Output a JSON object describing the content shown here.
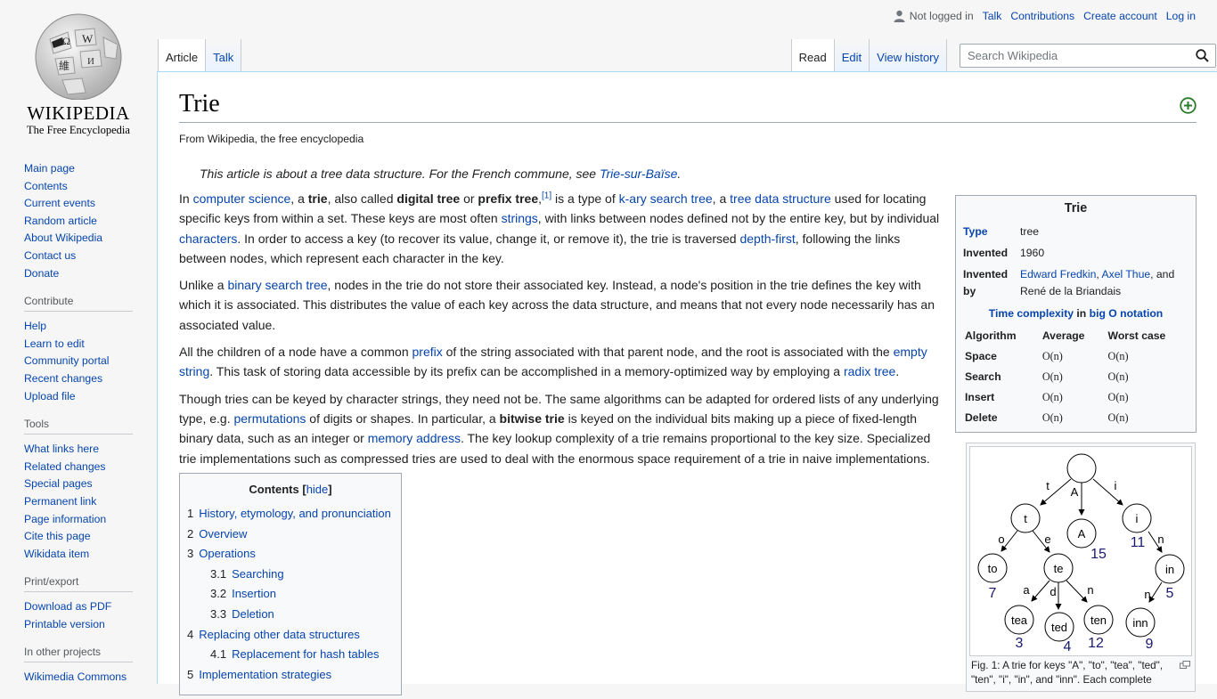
{
  "logo": {
    "wordmark": "WIKIPEDIA",
    "tagline": "The Free Encyclopedia"
  },
  "personal": {
    "not_logged_in": "Not logged in",
    "links": [
      "Talk",
      "Contributions",
      "Create account",
      "Log in"
    ]
  },
  "tabs_left": [
    "Article",
    "Talk"
  ],
  "tabs_right": [
    "Read",
    "Edit",
    "View history"
  ],
  "search": {
    "placeholder": "Search Wikipedia"
  },
  "sidebar": {
    "nav": [
      "Main page",
      "Contents",
      "Current events",
      "Random article",
      "About Wikipedia",
      "Contact us",
      "Donate"
    ],
    "contribute": {
      "heading": "Contribute",
      "items": [
        "Help",
        "Learn to edit",
        "Community portal",
        "Recent changes",
        "Upload file"
      ]
    },
    "tools": {
      "heading": "Tools",
      "items": [
        "What links here",
        "Related changes",
        "Special pages",
        "Permanent link",
        "Page information",
        "Cite this page",
        "Wikidata item"
      ]
    },
    "print": {
      "heading": "Print/export",
      "items": [
        "Download as PDF",
        "Printable version"
      ]
    },
    "projects": {
      "heading": "In other projects",
      "items": [
        "Wikimedia Commons"
      ]
    }
  },
  "article": {
    "title": "Trie",
    "tagline": "From Wikipedia, the free encyclopedia",
    "hatnote": {
      "text": "This article is about a tree data structure. For the French commune, see ",
      "link": "Trie-sur-Baïse",
      "end": "."
    },
    "p1": {
      "t1": "In ",
      "l1": "computer science",
      "t2": ", a ",
      "b1": "trie",
      "t3": ", also called ",
      "b2": "digital tree",
      "t4": " or ",
      "b3": "prefix tree",
      "t5": ",",
      "ref": "[1]",
      "t6": " is a type of ",
      "l2": "k-ary search tree",
      "t7": ", a ",
      "l3": "tree data structure",
      "t8": " used for locating specific keys from within a set. These keys are most often ",
      "l4": "strings",
      "t9": ", with links between nodes defined not by the entire key, but by individual ",
      "l5": "characters",
      "t10": ". In order to access a key (to recover its value, change it, or remove it), the trie is traversed ",
      "l6": "depth-first",
      "t11": ", following the links between nodes, which represent each character in the key."
    },
    "p2": {
      "t1": "Unlike a ",
      "l1": "binary search tree",
      "t2": ", nodes in the trie do not store their associated key. Instead, a node's position in the trie defines the key with which it is associated. This distributes the value of each key across the data structure, and means that not every node necessarily has an associated value."
    },
    "p3": {
      "t1": "All the children of a node have a common ",
      "l1": "prefix",
      "t2": " of the string associated with that parent node, and the root is associated with the ",
      "l2": "empty string",
      "t3": ". This task of storing data accessible by its prefix can be accomplished in a memory-optimized way by employing a ",
      "l3": "radix tree",
      "t4": "."
    },
    "p4": {
      "t1": "Though tries can be keyed by character strings, they need not be. The same algorithms can be adapted for ordered lists of any underlying type, e.g. ",
      "l1": "permutations",
      "t2": " of digits or shapes. In particular, a ",
      "b1": "bitwise trie",
      "t3": " is keyed on the individual bits making up a piece of fixed-length binary data, such as an integer or ",
      "l2": "memory address",
      "t4": ". The key lookup complexity of a trie remains proportional to the key size. Specialized trie implementations such as compressed tries are used to deal with the enormous space requirement of a trie in naive implementations."
    }
  },
  "toc": {
    "title": "Contents",
    "hide": "hide",
    "entries": [
      {
        "num": "1",
        "text": "History, etymology, and pronunciation"
      },
      {
        "num": "2",
        "text": "Overview"
      },
      {
        "num": "3",
        "text": "Operations"
      },
      {
        "num": "3.1",
        "text": "Searching"
      },
      {
        "num": "3.2",
        "text": "Insertion"
      },
      {
        "num": "3.3",
        "text": "Deletion"
      },
      {
        "num": "4",
        "text": "Replacing other data structures"
      },
      {
        "num": "4.1",
        "text": "Replacement for hash tables"
      },
      {
        "num": "5",
        "text": "Implementation strategies"
      }
    ]
  },
  "infobox": {
    "title": "Trie",
    "type_label": "Type",
    "type_value": "tree",
    "invented_label": "Invented",
    "invented_value": "1960",
    "by_label1": "Invented",
    "by_label2": "by",
    "by_l1": "Edward Fredkin",
    "by_sep": ", ",
    "by_l2": "Axel Thue",
    "by_and": ", and",
    "by_t2": "René de la Briandais",
    "tc_l1": "Time complexity",
    "tc_in": " in ",
    "tc_l2": "big O notation",
    "cols": [
      "Algorithm",
      "Average",
      "Worst case"
    ],
    "rows": [
      {
        "alg": "Space",
        "avg": "O(n)",
        "worst": "O(n)"
      },
      {
        "alg": "Search",
        "avg": "O(n)",
        "worst": "O(n)"
      },
      {
        "alg": "Insert",
        "avg": "O(n)",
        "worst": "O(n)"
      },
      {
        "alg": "Delete",
        "avg": "O(n)",
        "worst": "O(n)"
      }
    ]
  },
  "figure": {
    "caption": "Fig. 1: A trie for keys \"A\", \"to\", \"tea\", \"ted\", \"ten\", \"i\", \"in\", and \"inn\". Each complete",
    "nodes": [
      "t",
      "A",
      "i",
      "to",
      "te",
      "in",
      "tea",
      "ted",
      "ten",
      "inn"
    ],
    "edges": [
      "t",
      "A",
      "i",
      "o",
      "e",
      "n",
      "a",
      "d",
      "n",
      "n"
    ],
    "values": [
      "15",
      "11",
      "7",
      "5",
      "3",
      "4",
      "12",
      "9"
    ]
  }
}
